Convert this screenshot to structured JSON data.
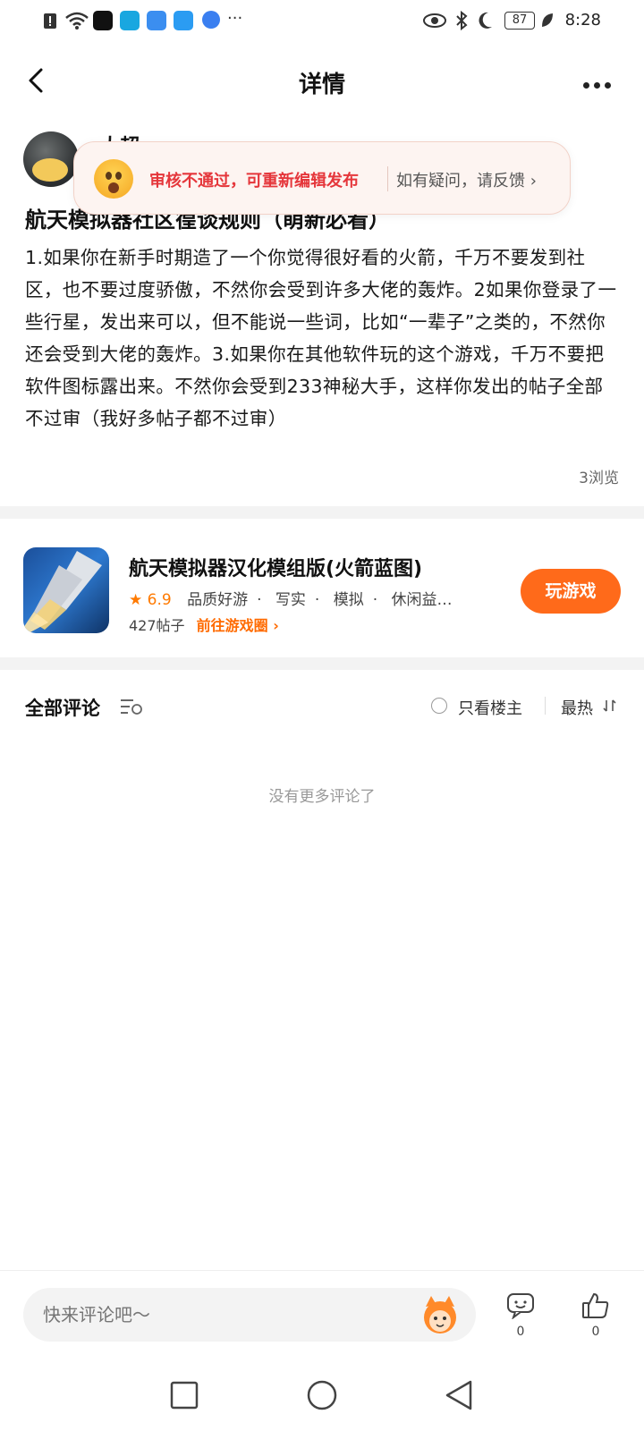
{
  "status_bar": {
    "time": "8:28",
    "battery": "87",
    "icons": [
      "alert-icon",
      "wifi-icon",
      "tiktok-icon",
      "app-icon",
      "cloud-icon",
      "search-app-icon",
      "browser-icon",
      "more-dots-icon",
      "eye-icon",
      "bluetooth-icon",
      "moon-icon",
      "battery-icon",
      "leaf-icon"
    ]
  },
  "header": {
    "title": "详情"
  },
  "author": {
    "name": "大超"
  },
  "toast": {
    "message": "审核不通过，可重新编辑发布",
    "feedback": "如有疑问，请反馈"
  },
  "post": {
    "title": "航天模拟器社区徨谈规则（萌新必看）",
    "body": "1.如果你在新手时期造了一个你觉得很好看的火箭，千万不要发到社区，也不要过度骄傲，不然你会受到许多大佬的轰炸。2如果你登录了一些行星，发出来可以，但不能说一些词，比如“一辈子”之类的，不然你还会受到大佬的轰炸。3.如果你在其他软件玩的这个游戏，千万不要把软件图标露出来。不然你会受到233神秘大手，这样你发出的帖子全部不过审（我好多帖子都不过审）",
    "views": "3浏览"
  },
  "game": {
    "name": "航天模拟器汉化模组版(火箭蓝图)",
    "rating": "6.9",
    "tags": [
      "品质好游",
      "写实",
      "模拟",
      "休闲益…"
    ],
    "posts": "427帖子",
    "goto_label": "前往游戏圈",
    "play_label": "玩游戏"
  },
  "comments": {
    "title": "全部评论",
    "only_host": "只看楼主",
    "sort": "最热",
    "empty": "没有更多评论了"
  },
  "bottom": {
    "input_placeholder": "快来评论吧～",
    "comment_count": "0",
    "like_count": "0"
  },
  "colors": {
    "accent": "#ff6a1a",
    "error": "#e5363b",
    "link": "#ff6a00"
  }
}
